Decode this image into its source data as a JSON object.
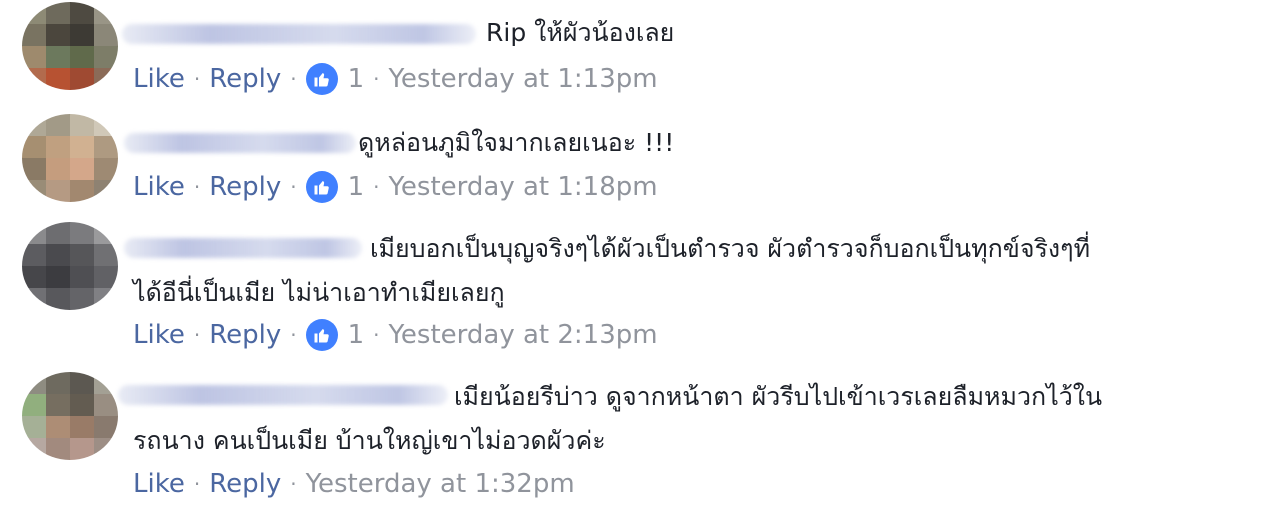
{
  "comments": [
    {
      "text": [
        "Rip ให้ผัวน้องเลย"
      ],
      "like_label": "Like",
      "reply_label": "Reply",
      "reactions": "1",
      "timestamp": "Yesterday at 1:13pm"
    },
    {
      "text": [
        "ดูหล่อนภูมิใจมากเลยเนอะ !!!"
      ],
      "like_label": "Like",
      "reply_label": "Reply",
      "reactions": "1",
      "timestamp": "Yesterday at 1:18pm"
    },
    {
      "text": [
        "เมียบอกเป็นบุญจริงๆได้ผัวเป็นตำรวจ ผัวตำรวจก็บอกเป็นทุกข์จริงๆที่",
        "ได้อีนี่เป็นเมีย ไม่น่าเอาทำเมียเลยกู"
      ],
      "like_label": "Like",
      "reply_label": "Reply",
      "reactions": "1",
      "timestamp": "Yesterday at 2:13pm"
    },
    {
      "text": [
        "เมียน้อยรีบ่าว ดูจากหน้าตา ผัวรีบไปเข้าเวรเลยลืมหมวกไว้ใน",
        "รถนาง คนเป็นเมีย บ้านใหญ่เขาไม่อวดผัวค่ะ"
      ],
      "like_label": "Like",
      "reply_label": "Reply",
      "reactions": "",
      "timestamp": "Yesterday at 1:32pm"
    }
  ],
  "colors": {
    "link": "#4b67a1",
    "meta": "#90949c",
    "text": "#1d2129",
    "like_badge": "#4080ff"
  },
  "icons": {
    "reaction": "thumbs-up-icon"
  }
}
